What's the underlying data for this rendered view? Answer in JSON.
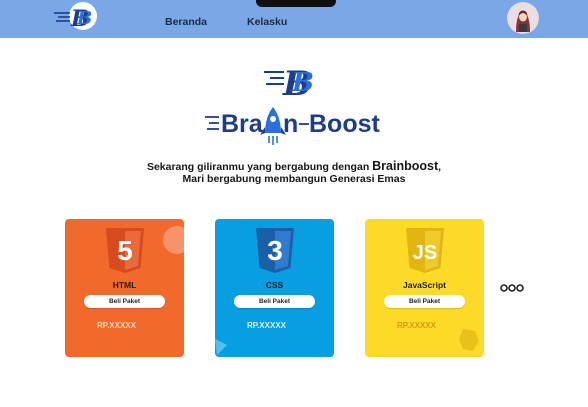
{
  "navbar": {
    "logo_icon": "brainboost-b-logo-icon",
    "links": [
      {
        "label": "Beranda",
        "icon": ""
      },
      {
        "label": "Kelasku",
        "icon": ""
      }
    ],
    "avatar_icon": "user-avatar-icon"
  },
  "brand": {
    "mark_icon": "brainboost-b-mark-icon",
    "word_left": "Bra",
    "word_right": "Boost",
    "rocket_icon": "rocket-icon"
  },
  "tagline": {
    "line1_prefix": "Sekarang giliranmu yang bergabung dengan ",
    "line1_brand": "Brainboost",
    "line1_suffix": ",",
    "line2": "Mari bergabung membangun Generasi Emas"
  },
  "courses": [
    {
      "title": "HTML",
      "button": "Beli Paket",
      "price": "RP.XXXXX",
      "icon": "html5-icon",
      "badge_number": "5",
      "color": "#f16a2b"
    },
    {
      "title": "CSS",
      "button": "Beli Paket",
      "price": "RP.XXXXX",
      "icon": "css3-icon",
      "badge_number": "3",
      "color": "#089ee2"
    },
    {
      "title": "JavaScript",
      "button": "Beli Paket",
      "price": "RP.XXXXX",
      "icon": "js-icon",
      "badge_number": "JS",
      "color": "#fdd928"
    }
  ],
  "more": {
    "icon": "more-dots-icon"
  },
  "colors": {
    "navbar": "#7aa7e6",
    "brand_blue": "#1d3d8c",
    "accent": "#2a6fdb"
  }
}
